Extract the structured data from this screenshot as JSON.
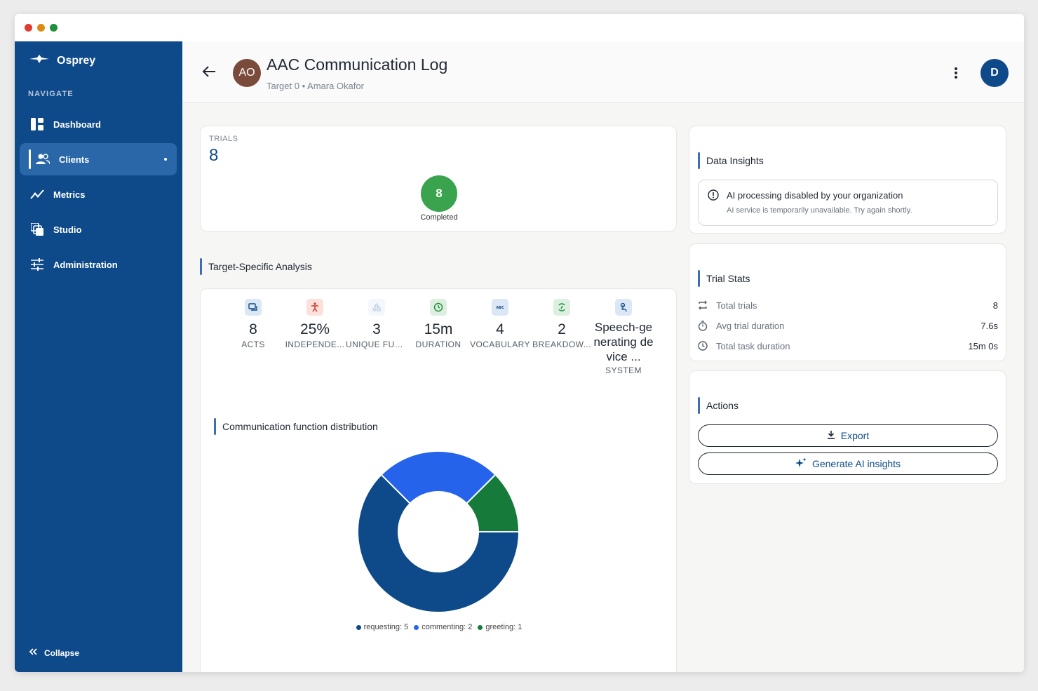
{
  "brand": {
    "name": "Osprey"
  },
  "sidebar": {
    "heading": "NAVIGATE",
    "items": [
      {
        "label": "Dashboard",
        "icon": "dashboard-icon"
      },
      {
        "label": "Clients",
        "icon": "people-icon",
        "active": true
      },
      {
        "label": "Metrics",
        "icon": "trend-icon"
      },
      {
        "label": "Studio",
        "icon": "layers-icon"
      },
      {
        "label": "Administration",
        "icon": "sliders-icon"
      }
    ],
    "collapse_label": "Collapse"
  },
  "header": {
    "avatar_initials": "AO",
    "title": "AAC Communication Log",
    "subtitle": "Target 0 • Amara Okafor",
    "user_initial": "D"
  },
  "trials": {
    "label": "TRIALS",
    "value": "8",
    "completed_count": "8",
    "completed_label": "Completed"
  },
  "analysis": {
    "title": "Target-Specific Analysis",
    "metrics": [
      {
        "value": "8",
        "label": "ACTS",
        "icon": "chat-icon"
      },
      {
        "value": "25%",
        "label": "INDEPENDE...",
        "icon": "person-icon"
      },
      {
        "value": "3",
        "label": "UNIQUE FUN...",
        "icon": "shapes-icon"
      },
      {
        "value": "15m",
        "label": "DURATION",
        "icon": "clock-icon"
      },
      {
        "value": "4",
        "label": "VOCABULARY",
        "icon": "abc-icon"
      },
      {
        "value": "2",
        "label": "BREAKDOW...",
        "icon": "repair-icon"
      },
      {
        "value": "Speech-generating device ...",
        "label": "SYSTEM",
        "icon": "touch-icon"
      }
    ],
    "chart_title": "Communication function distribution",
    "legend": [
      "requesting: 5",
      "commenting: 2",
      "greeting: 1"
    ]
  },
  "chart_data": {
    "type": "pie",
    "title": "Communication function distribution",
    "categories": [
      "requesting",
      "commenting",
      "greeting"
    ],
    "values": [
      5,
      2,
      1
    ],
    "colors": [
      "#0e4a8a",
      "#2563eb",
      "#157a3a"
    ],
    "donut": true
  },
  "insights": {
    "title": "Data Insights",
    "notice_title": "AI processing disabled by your organization",
    "notice_desc": "AI service is temporarily unavailable. Try again shortly."
  },
  "stats": {
    "title": "Trial Stats",
    "rows": [
      {
        "label": "Total trials",
        "value": "8",
        "icon": "repeat-icon"
      },
      {
        "label": "Avg trial duration",
        "value": "7.6s",
        "icon": "stopwatch-icon"
      },
      {
        "label": "Total task duration",
        "value": "15m 0s",
        "icon": "clock-icon"
      }
    ]
  },
  "actions": {
    "title": "Actions",
    "export_label": "Export",
    "generate_label": "Generate AI insights"
  },
  "colors": {
    "sidebar": "#0e4a8a",
    "accent": "#2563eb",
    "success": "#3aa34d"
  }
}
